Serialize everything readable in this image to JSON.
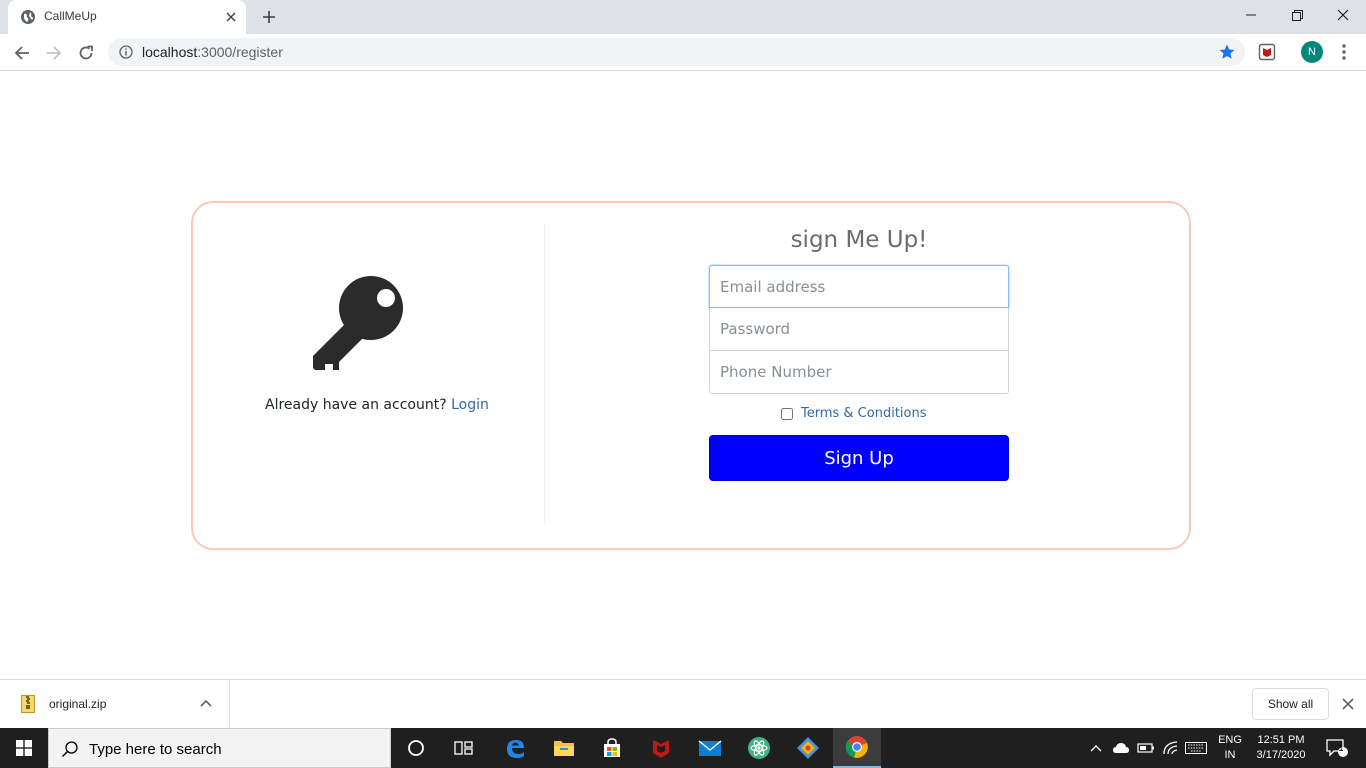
{
  "browser": {
    "tab": {
      "title": "CallMeUp"
    },
    "url": {
      "host": "localhost",
      "path": ":3000/register"
    },
    "profile_initial": "N"
  },
  "page": {
    "left": {
      "already_text": "Already have an account?",
      "login_label": "Login"
    },
    "form": {
      "title": "sign Me Up!",
      "email_placeholder": "Email address",
      "password_placeholder": "Password",
      "phone_placeholder": "Phone Number",
      "terms_label": "Terms & Conditions",
      "submit_label": "Sign Up"
    },
    "colors": {
      "card_border": "#f9c9b8",
      "submit_bg": "#0000ff",
      "link": "#2d6aa8"
    }
  },
  "downloads": {
    "file_name": "original.zip",
    "show_all_label": "Show all"
  },
  "taskbar": {
    "search_placeholder": "Type here to search",
    "language": "ENG",
    "region": "IN",
    "time": "12:51 PM",
    "date": "3/17/2020",
    "notification_count": "1"
  }
}
